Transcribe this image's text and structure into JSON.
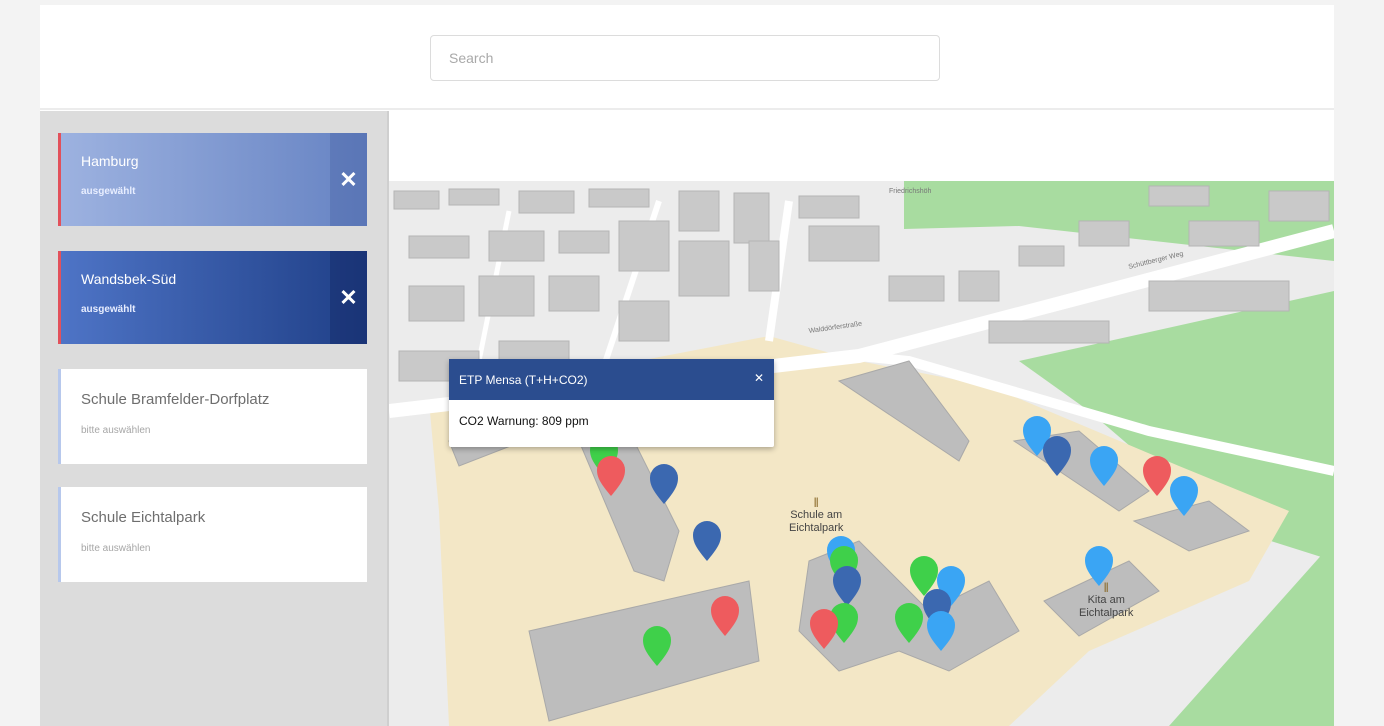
{
  "search": {
    "placeholder": "Search"
  },
  "sidebar": {
    "selected": [
      {
        "title": "Hamburg",
        "status": "ausgewählt"
      },
      {
        "title": "Wandsbek-Süd",
        "status": "ausgewählt"
      }
    ],
    "options": [
      {
        "title": "Schule Bramfelder-Dorfplatz",
        "status": "bitte auswählen"
      },
      {
        "title": "Schule Eichtalpark",
        "status": "bitte auswählen"
      }
    ],
    "remove_icon": "close-icon"
  },
  "map": {
    "labels": {
      "poi1_line1": "Schule am",
      "poi1_line2": "Eichtalpark",
      "poi2_line1": "Kita am",
      "poi2_line2": "Eichtalpark",
      "street1": "Friedrichshöh",
      "street2": "Walddörferstraße",
      "street3": "Schüttberger Weg"
    },
    "colors": {
      "pin_green": "#3fd04a",
      "pin_red": "#ee5b5e",
      "pin_blue_light": "#3aa5f4",
      "pin_blue_dark": "#3b68b0",
      "park": "#a8dca0",
      "school_ground": "#f3e7c6"
    }
  },
  "popup": {
    "title": "ETP Mensa (T+H+CO2)",
    "message": "CO2 Warnung: 809 ppm",
    "close_icon": "close-icon"
  }
}
